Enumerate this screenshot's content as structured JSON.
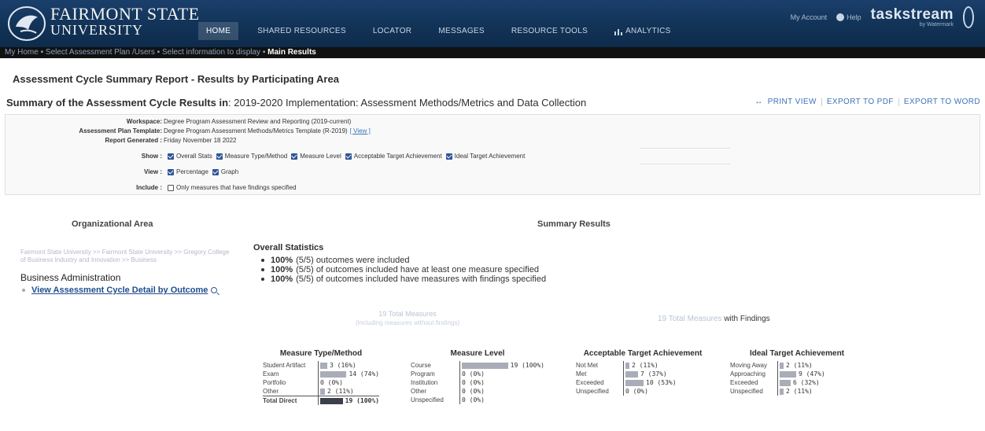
{
  "header": {
    "university_line1": "FAIRMONT STATE",
    "university_line2": "UNIVERSITY",
    "nav": [
      "HOME",
      "SHARED RESOURCES",
      "LOCATOR",
      "MESSAGES",
      "RESOURCE TOOLS",
      "ANALYTICS"
    ],
    "active_nav": "HOME",
    "my_account": "My Account",
    "help": "Help",
    "brand": "taskstream",
    "brand_sub": "by Watermark",
    "colors": {
      "header_bg": "#123357",
      "breadcrumb_bg": "#111111",
      "link": "#3b72b8"
    }
  },
  "breadcrumb": {
    "items": [
      "My Home",
      "Select Assessment Plan /Users",
      "Select information to display"
    ],
    "current": "Main Results"
  },
  "report": {
    "title": "Assessment Cycle Summary Report - Results by Participating Area",
    "summary_label": "Summary of the Assessment Cycle Results in",
    "summary_value": ": 2019-2020 Implementation: Assessment Methods/Metrics and Data Collection",
    "actions": [
      "PRINT VIEW",
      "EXPORT TO PDF",
      "EXPORT TO WORD"
    ]
  },
  "filters": {
    "workspace_label": "Workspace:",
    "workspace_value": "Degree Program Assessment Review and Reporting (2019-current)",
    "template_label": "Assessment Plan Template:",
    "template_value": "Degree Program Assessment Methods/Metrics Template (R-2019)",
    "template_link": "[ View ]",
    "generated_label": "Report Generated :",
    "generated_value": "Friday November 18 2022",
    "show_label": "Show :",
    "show_options": [
      "Overall Stats",
      "Measure Type/Method",
      "Measure Level",
      "Acceptable Target Achievement",
      "Ideal Target Achievement"
    ],
    "view_label": "View :",
    "view_options": [
      "Percentage",
      "Graph"
    ],
    "include_label": "Include :",
    "include_option": "Only measures that have findings specified"
  },
  "org": {
    "header": "Organizational Area",
    "path": "Fairmont State University >> Fairmont State University >> Gregory College of Business Industry and Innovation >> Business",
    "name": "Business Administration",
    "link": "View Assessment Cycle Detail by Outcome"
  },
  "summary": {
    "header": "Summary Results",
    "overall_title": "Overall Statistics",
    "stats": [
      {
        "pct": "100%",
        "text": "(5/5) outcomes were included"
      },
      {
        "pct": "100%",
        "text": "(5/5) of outcomes included have at least one measure specified"
      },
      {
        "pct": "100%",
        "text": "(5/5) of outcomes included have measures with findings specified"
      }
    ],
    "total_measures": "19 Total Measures",
    "total_measures_sub": "(Including measures without findings)",
    "total_findings_faint": "19 Total Measures",
    "total_findings_rest": "with Findings"
  },
  "breakdowns": [
    {
      "title": "Measure Type/Method",
      "rows": [
        {
          "label": "Student Artifact",
          "value": "3 (16%)",
          "pct": 16
        },
        {
          "label": "Exam",
          "value": "14 (74%)",
          "pct": 74
        },
        {
          "label": "Portfolio",
          "value": "0 (0%)",
          "pct": 0
        },
        {
          "label": "Other",
          "value": "2 (11%)",
          "pct": 11
        }
      ],
      "total": {
        "label": "Total Direct",
        "value": "19 (100%)",
        "pct": 100
      }
    },
    {
      "title": "Measure Level",
      "rows": [
        {
          "label": "Course",
          "value": "19 (100%)",
          "pct": 100
        },
        {
          "label": "Program",
          "value": "0 (0%)",
          "pct": 0
        },
        {
          "label": "Institution",
          "value": "0 (0%)",
          "pct": 0
        },
        {
          "label": "Other",
          "value": "0 (0%)",
          "pct": 0
        },
        {
          "label": "Unspecified",
          "value": "0 (0%)",
          "pct": 0
        }
      ]
    },
    {
      "title": "Acceptable Target Achievement",
      "rows": [
        {
          "label": "Not Met",
          "value": "2 (11%)",
          "pct": 11
        },
        {
          "label": "Met",
          "value": "7 (37%)",
          "pct": 37
        },
        {
          "label": "Exceeded",
          "value": "10 (53%)",
          "pct": 53
        },
        {
          "label": "Unspecified",
          "value": "0 (0%)",
          "pct": 0
        }
      ]
    },
    {
      "title": "Ideal Target Achievement",
      "rows": [
        {
          "label": "Moving Away",
          "value": "2 (11%)",
          "pct": 11
        },
        {
          "label": "Approaching",
          "value": "9 (47%)",
          "pct": 47
        },
        {
          "label": "Exceeded",
          "value": "6 (32%)",
          "pct": 32
        },
        {
          "label": "Unspecified",
          "value": "2 (11%)",
          "pct": 11
        }
      ]
    }
  ]
}
